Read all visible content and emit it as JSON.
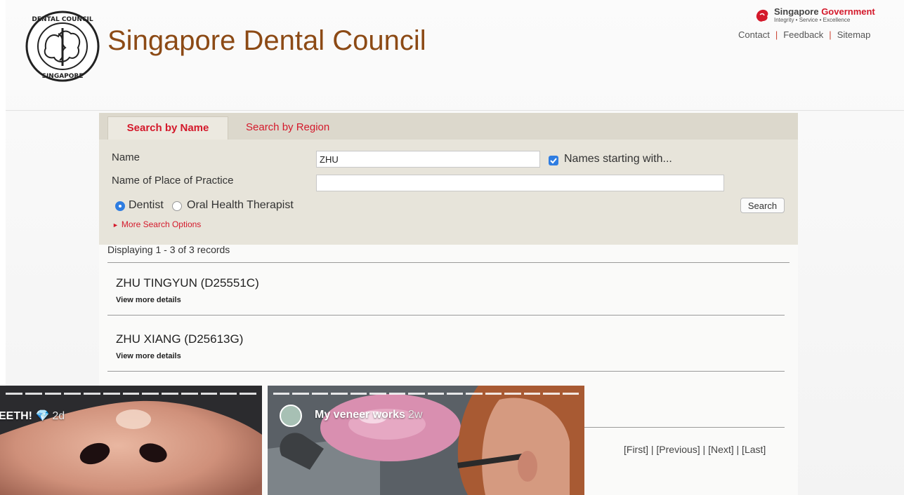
{
  "header": {
    "title": "Singapore Dental Council",
    "seal_text": "DENTAL COUNCIL SINGAPORE",
    "gov_name_part1": "Singapore ",
    "gov_name_part2": "Government",
    "gov_tagline": "Integrity • Service • Excellence",
    "links": [
      "Contact",
      "Feedback",
      "Sitemap"
    ]
  },
  "tabs": {
    "active": "Search by Name",
    "other": "Search by Region"
  },
  "form": {
    "name_label": "Name",
    "name_value": "ZHU",
    "starting_with_label": "Names starting with...",
    "starting_with_checked": true,
    "practice_label": "Name of Place of Practice",
    "practice_value": "",
    "radio_dentist": "Dentist",
    "radio_oht": "Oral Health Therapist",
    "search_button": "Search",
    "more_options": "More Search Options"
  },
  "results": {
    "count_text": "Displaying 1 - 3 of 3 records",
    "items": [
      {
        "name": "ZHU TINGYUN (D25551C)",
        "link": "View more details"
      },
      {
        "name": "ZHU XIANG (D25613G)",
        "link": "View more details"
      }
    ],
    "pager": "[First] | [Previous] | [Next] | [Last]"
  },
  "stories": [
    {
      "caption": "EETH! 💎",
      "time": "2d"
    },
    {
      "caption": "My veneer works",
      "time": "2w"
    }
  ],
  "colors": {
    "brand_brown": "#8c4a15",
    "accent_red": "#d4192b",
    "checkbox_blue": "#2f7de1"
  }
}
